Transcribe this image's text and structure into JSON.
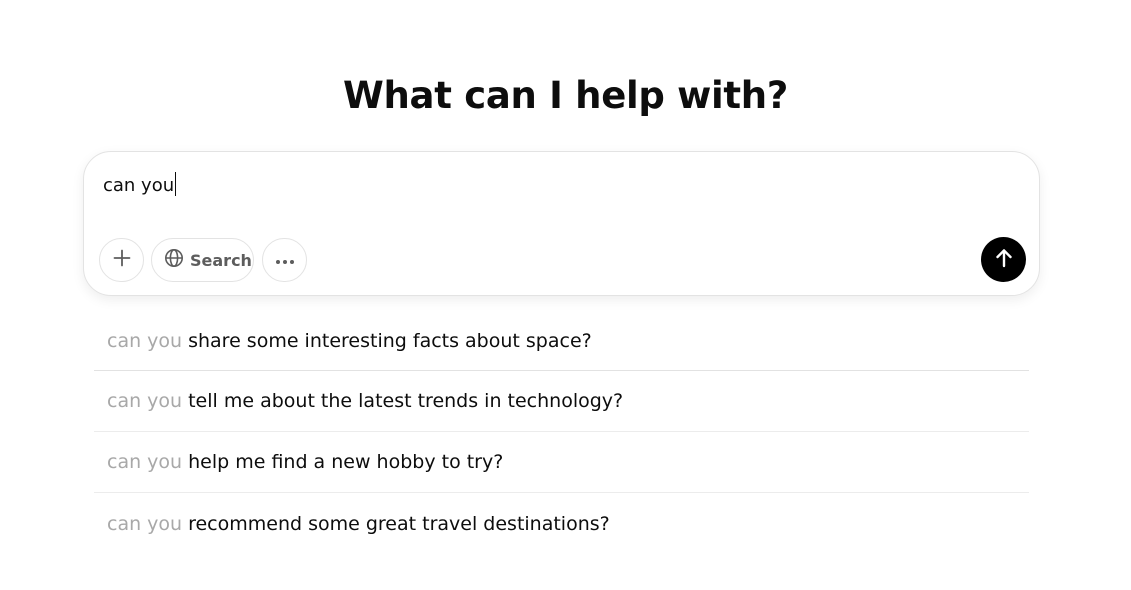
{
  "header": {
    "title": "What can I help with?"
  },
  "composer": {
    "input_value": "can you",
    "buttons": {
      "add_icon": "plus-icon",
      "search_icon": "globe-icon",
      "search_label": "Search",
      "more_icon": "ellipsis-icon",
      "send_icon": "arrow-up-icon"
    },
    "send_button_color": "#000000"
  },
  "suggestions": {
    "items": [
      {
        "prefix": "can you",
        "text": "share some interesting facts about space?"
      },
      {
        "prefix": "can you",
        "text": "tell me about the latest trends in technology?"
      },
      {
        "prefix": "can you",
        "text": "help me find a new hobby to try?"
      },
      {
        "prefix": "can you",
        "text": "recommend some great travel destinations?"
      }
    ],
    "prefix_color": "#a8a8a8"
  }
}
